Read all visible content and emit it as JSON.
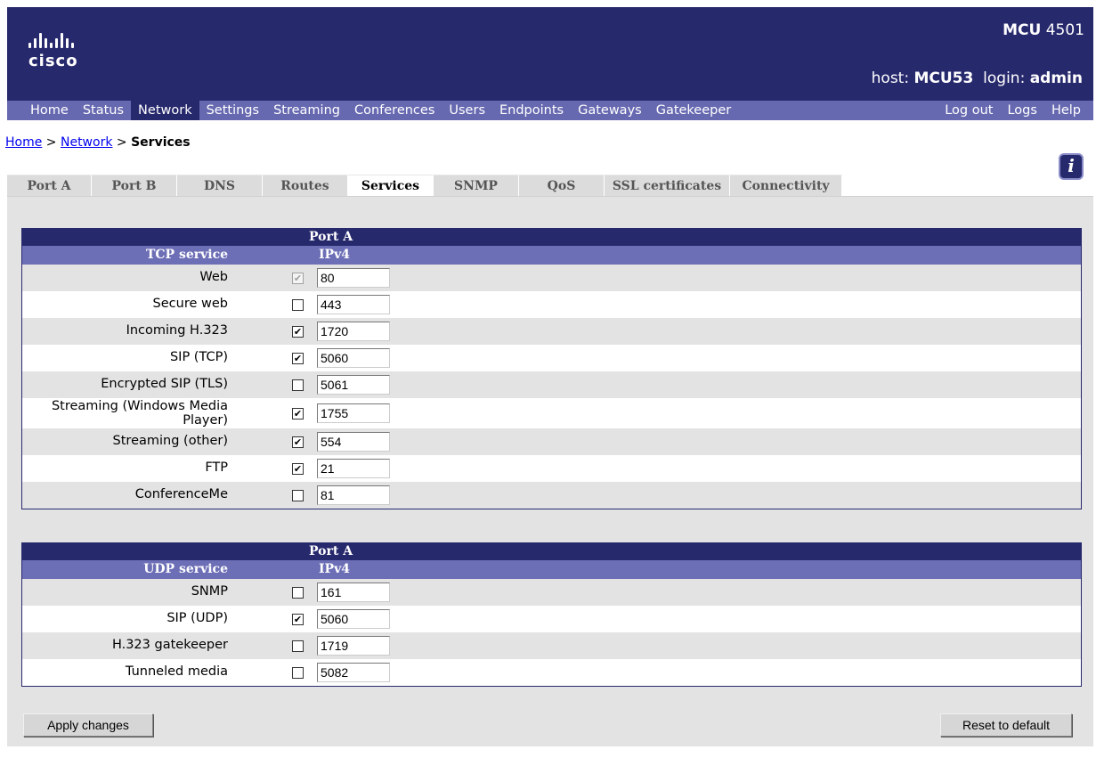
{
  "header": {
    "logo_text": "cisco",
    "product_bold": "MCU",
    "product_model": "4501",
    "host_label": "host:",
    "host_value": "MCU53",
    "login_label": "login:",
    "login_value": "admin",
    "background_color": "#27296d"
  },
  "nav": {
    "items": [
      "Home",
      "Status",
      "Network",
      "Settings",
      "Streaming",
      "Conferences",
      "Users",
      "Endpoints",
      "Gateways",
      "Gatekeeper"
    ],
    "active": "Network",
    "right_items": [
      "Log out",
      "Logs",
      "Help"
    ],
    "background_color": "#6668b0"
  },
  "breadcrumb": {
    "home": "Home",
    "separator": ">",
    "network": "Network",
    "current": "Services"
  },
  "tabs": {
    "items": [
      "Port A",
      "Port B",
      "DNS",
      "Routes",
      "Services",
      "SNMP",
      "QoS",
      "SSL certificates",
      "Connectivity"
    ],
    "active": "Services"
  },
  "tcp_table": {
    "port_header": "Port A",
    "service_header": "TCP service",
    "ip_header": "IPv4",
    "rows": [
      {
        "label": "Web",
        "checked": true,
        "disabled": true,
        "port": "80"
      },
      {
        "label": "Secure web",
        "checked": false,
        "disabled": false,
        "port": "443"
      },
      {
        "label": "Incoming H.323",
        "checked": true,
        "disabled": false,
        "port": "1720"
      },
      {
        "label": "SIP (TCP)",
        "checked": true,
        "disabled": false,
        "port": "5060"
      },
      {
        "label": "Encrypted SIP (TLS)",
        "checked": false,
        "disabled": false,
        "port": "5061"
      },
      {
        "label": "Streaming (Windows Media Player)",
        "checked": true,
        "disabled": false,
        "port": "1755"
      },
      {
        "label": "Streaming (other)",
        "checked": true,
        "disabled": false,
        "port": "554"
      },
      {
        "label": "FTP",
        "checked": true,
        "disabled": false,
        "port": "21"
      },
      {
        "label": "ConferenceMe",
        "checked": false,
        "disabled": false,
        "port": "81"
      }
    ]
  },
  "udp_table": {
    "port_header": "Port A",
    "service_header": "UDP service",
    "ip_header": "IPv4",
    "rows": [
      {
        "label": "SNMP",
        "checked": false,
        "disabled": false,
        "port": "161"
      },
      {
        "label": "SIP (UDP)",
        "checked": true,
        "disabled": false,
        "port": "5060"
      },
      {
        "label": "H.323 gatekeeper",
        "checked": false,
        "disabled": false,
        "port": "1719"
      },
      {
        "label": "Tunneled media",
        "checked": false,
        "disabled": false,
        "port": "5082"
      }
    ]
  },
  "buttons": {
    "apply": "Apply changes",
    "reset": "Reset to default"
  },
  "icons": {
    "info": "info-icon",
    "logo": "cisco-logo-icon"
  }
}
